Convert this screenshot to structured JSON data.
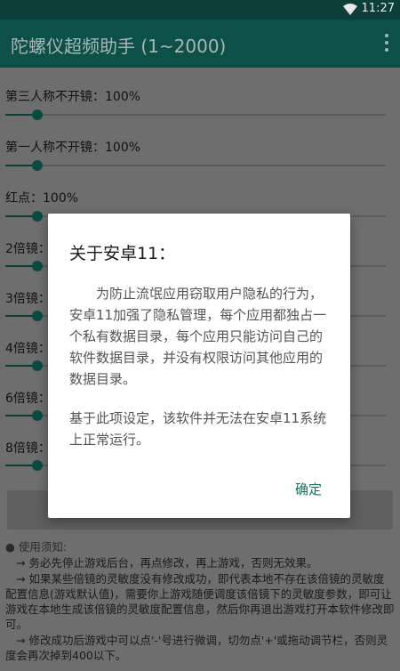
{
  "status_bar": {
    "time": "11:27"
  },
  "app_bar": {
    "title": "陀螺仪超频助手 (1~2000)"
  },
  "settings": [
    {
      "label": "第三人称不开镜：100%",
      "value": 100
    },
    {
      "label": "第一人称不开镜：100%",
      "value": 100
    },
    {
      "label": "红点：100%",
      "value": 100
    },
    {
      "label": "2倍镜：",
      "value": 100
    },
    {
      "label": "3倍镜：",
      "value": 100
    },
    {
      "label": "4倍镜：",
      "value": 100
    },
    {
      "label": "6倍镜：",
      "value": 100
    },
    {
      "label": "8倍镜：",
      "value": 100
    }
  ],
  "notes": {
    "heading": "● 使用须知:",
    "items": [
      "→ 务必先停止游戏后台，再点修改，再上游戏，否则无效果。",
      "→ 如果某些倍镜的灵敏度没有修改成功，即代表本地不存在该倍镜的灵敏度配置信息(游戏默认值)，需要你上游戏随便调度该倍镜下的灵敏度参数，即可让游戏在本地生成该倍镜的灵敏度配置信息，然后你再退出游戏打开本软件修改即可。",
      "→ 修改成功后游戏中可以点'-'号进行微调，切勿点'+'或拖动调节栏，否则灵度会再次掉到400以下。"
    ]
  },
  "dialog": {
    "title": "关于安卓11：",
    "paragraph1": "为防止流氓应用窃取用户隐私的行为，安卓11加强了隐私管理，每个应用都独占一个私有数据目录，每个应用只能访问自己的软件数据目录，并没有权限访问其他应用的数据目录。",
    "paragraph2": "基于此项设定，该软件并无法在安卓11系统上正常运行。",
    "ok_label": "确定"
  },
  "colors": {
    "app_bar": "#0d5047",
    "accent": "#1b6f62",
    "scrim_background": "#6e6e6e"
  }
}
